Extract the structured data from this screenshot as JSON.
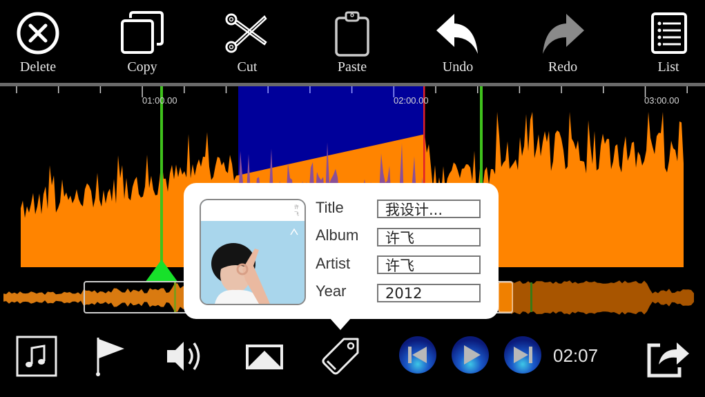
{
  "toolbar": {
    "buttons": [
      {
        "id": "delete",
        "label": "Delete",
        "icon": "circle-x-icon"
      },
      {
        "id": "copy",
        "label": "Copy",
        "icon": "copy-icon"
      },
      {
        "id": "cut",
        "label": "Cut",
        "icon": "scissors-icon"
      },
      {
        "id": "paste",
        "label": "Paste",
        "icon": "clipboard-icon"
      },
      {
        "id": "undo",
        "label": "Undo",
        "icon": "undo-arrow-icon"
      },
      {
        "id": "redo",
        "label": "Redo",
        "icon": "redo-arrow-icon",
        "disabled": true
      },
      {
        "id": "list",
        "label": "List",
        "icon": "list-icon"
      }
    ]
  },
  "timeline": {
    "tick_labels": [
      "01:00.00",
      "02:00.00",
      "03:00.00"
    ]
  },
  "colors": {
    "waveform": "#ff8400",
    "selection_bg": "#00009a",
    "selection_wave": "#8a4f98",
    "marker_green": "#3fc21c",
    "marker_red": "#e0202a",
    "overview_dim": "#a85500"
  },
  "metadata_popover": {
    "fields": [
      {
        "label": "Title",
        "value": "我设计..."
      },
      {
        "label": "Album",
        "value": "许飞"
      },
      {
        "label": "Artist",
        "value": "许飞"
      },
      {
        "label": "Year",
        "value": "2012"
      }
    ]
  },
  "bottom_bar": {
    "icons": [
      "music-note-icon",
      "flag-icon",
      "speaker-icon",
      "airplay-icon",
      "tag-icon"
    ],
    "transport": [
      "skip-back-icon",
      "play-icon",
      "skip-forward-icon"
    ],
    "current_time": "02:07",
    "share_icon": "share-export-icon"
  }
}
